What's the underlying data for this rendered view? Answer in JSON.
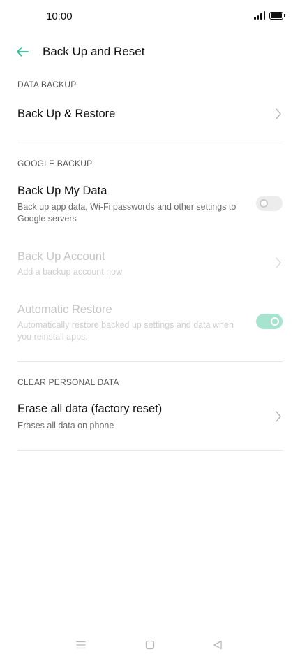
{
  "status_bar": {
    "time": "10:00"
  },
  "header": {
    "title": "Back Up and Reset"
  },
  "sections": {
    "data_backup": {
      "header": "DATA BACKUP",
      "back_up_restore": {
        "title": "Back Up & Restore"
      }
    },
    "google_backup": {
      "header": "GOOGLE BACKUP",
      "back_up_my_data": {
        "title": "Back Up My Data",
        "subtitle": "Back up app data, Wi-Fi passwords and other settings to Google servers",
        "toggle": "off"
      },
      "back_up_account": {
        "title": "Back Up Account",
        "subtitle": "Add a backup account now",
        "enabled": false
      },
      "automatic_restore": {
        "title": "Automatic Restore",
        "subtitle": "Automatically restore backed up settings and data when you reinstall apps.",
        "toggle": "on",
        "enabled": false
      }
    },
    "clear_personal_data": {
      "header": "CLEAR PERSONAL DATA",
      "erase_all_data": {
        "title": "Erase all data (factory reset)",
        "subtitle": "Erases all data on phone"
      }
    }
  },
  "colors": {
    "accent": "#2fbf8f",
    "toggle_on_disabled": "#a6e4cf"
  },
  "icons": {
    "back": "arrow-left-icon",
    "chevron": "chevron-right-icon",
    "nav_menu": "menu-icon",
    "nav_home": "home-square-icon",
    "nav_back": "back-triangle-icon"
  }
}
